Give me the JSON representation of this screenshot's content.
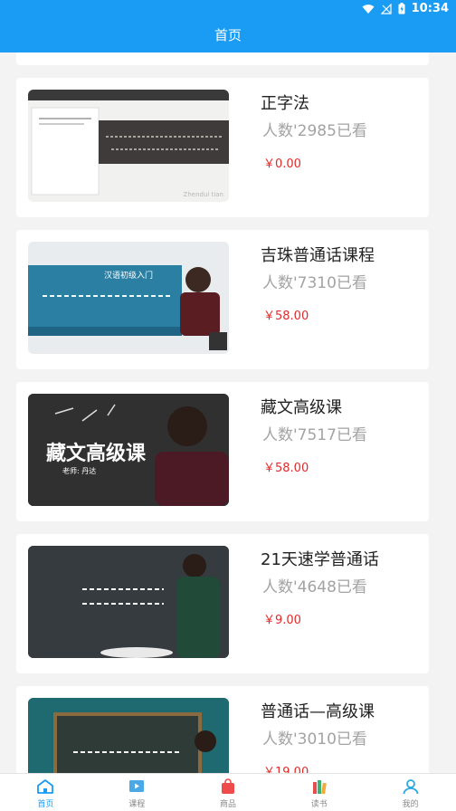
{
  "status": {
    "time": "10:34"
  },
  "header": {
    "title": "首页"
  },
  "courses": [
    {
      "title": "正字法",
      "viewers": "人数'2985已看",
      "price": "￥0.00",
      "thumb_text": "Zhendui tian"
    },
    {
      "title": "吉珠普通话课程",
      "viewers": "人数'7310已看",
      "price": "￥58.00",
      "thumb_text": "汉语初级入门"
    },
    {
      "title": "藏文高级课",
      "viewers": "人数'7517已看",
      "price": "￥58.00",
      "thumb_title": "藏文高级课",
      "thumb_teacher": "老师:  丹达"
    },
    {
      "title": "21天速学普通话",
      "viewers": "人数'4648已看",
      "price": "￥9.00"
    },
    {
      "title": "普通话—高级课",
      "viewers": "人数'3010已看",
      "price": "￥19.00"
    }
  ],
  "tabs": [
    {
      "label": "首页",
      "icon": "home-icon",
      "active": true
    },
    {
      "label": "课程",
      "icon": "video-icon",
      "active": false
    },
    {
      "label": "商品",
      "icon": "bag-icon",
      "active": false
    },
    {
      "label": "读书",
      "icon": "books-icon",
      "active": false
    },
    {
      "label": "我的",
      "icon": "user-icon",
      "active": false
    }
  ],
  "colors": {
    "primary": "#1a9cf4",
    "price": "#e12a2a",
    "muted": "#a3a3a3"
  }
}
